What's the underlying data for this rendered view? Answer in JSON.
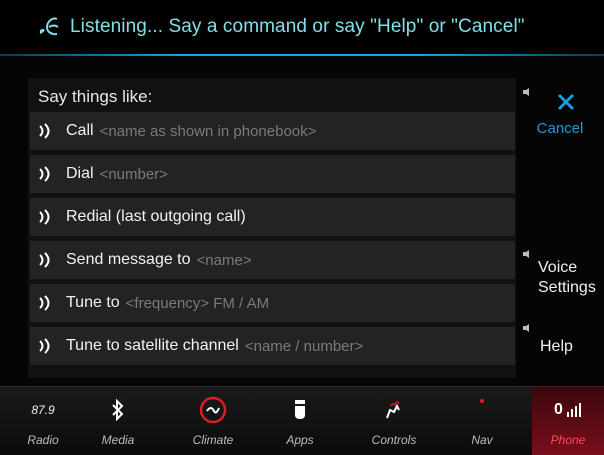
{
  "header": {
    "title": "Listening... Say a command or say \"Help\" or \"Cancel\"",
    "icon": "voice-recognition-icon"
  },
  "panel": {
    "heading": "Say things like:",
    "commands": [
      {
        "label": "Call",
        "hint": "<name as shown in phonebook>"
      },
      {
        "label": "Dial",
        "hint": "<number>"
      },
      {
        "label": "Redial (last outgoing call)",
        "hint": ""
      },
      {
        "label": "Send message to",
        "hint": "<name>"
      },
      {
        "label": "Tune to",
        "hint": "<frequency> FM / AM"
      },
      {
        "label": "Tune to satellite channel",
        "hint": "<name / number>"
      }
    ]
  },
  "side": {
    "cancel_label": "Cancel",
    "voice_label": "Voice Settings",
    "help_label": "Help"
  },
  "nav": {
    "items": [
      {
        "label": "Radio",
        "value": "87.9",
        "icon": "radio-frequency"
      },
      {
        "label": "Media",
        "icon": "bluetooth-icon"
      },
      {
        "label": "Climate",
        "icon": "climate-icon"
      },
      {
        "label": "Apps",
        "icon": "apps-icon"
      },
      {
        "label": "Controls",
        "icon": "controls-icon"
      },
      {
        "label": "Nav",
        "icon": "nav-icon"
      },
      {
        "label": "Phone",
        "icon": "phone-signal-icon",
        "value": "0"
      }
    ]
  },
  "colors": {
    "accent_cyan": "#7fe0e8",
    "accent_blue": "#1e9ad8",
    "phone_red": "#ff4b59"
  }
}
